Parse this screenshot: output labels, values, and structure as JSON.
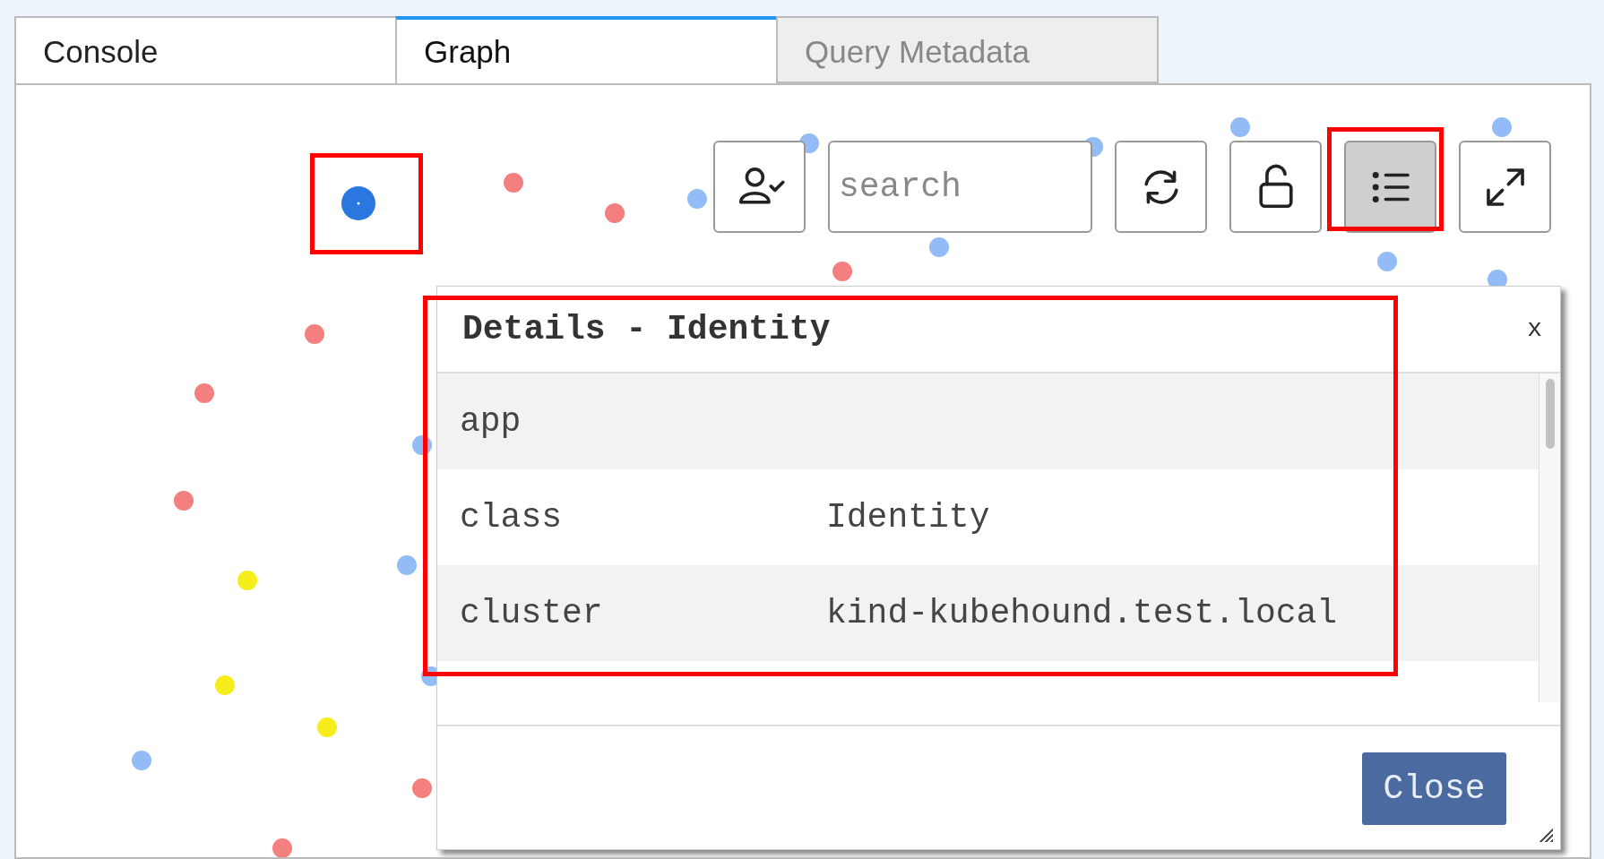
{
  "tabs": [
    {
      "label": "Console",
      "selected": false,
      "disabled": false
    },
    {
      "label": "Graph",
      "selected": true,
      "disabled": false
    },
    {
      "label": "Query Metadata",
      "selected": false,
      "disabled": true
    }
  ],
  "toolbar": [
    {
      "kind": "identity-filter",
      "selected": false
    },
    {
      "kind": "search",
      "placeholder": "search"
    },
    {
      "kind": "refresh",
      "selected": false
    },
    {
      "kind": "lock",
      "selected": false
    },
    {
      "kind": "details",
      "selected": true
    },
    {
      "kind": "fullscreen",
      "selected": false
    }
  ],
  "dialog": {
    "title": "Details - Identity",
    "close_label": "x",
    "rows": [
      {
        "key": "app"
      },
      {
        "key": "class",
        "value": "Identity"
      },
      {
        "key": "cluster",
        "value": "kind-kubehound.test.local"
      }
    ],
    "button": "Close"
  }
}
